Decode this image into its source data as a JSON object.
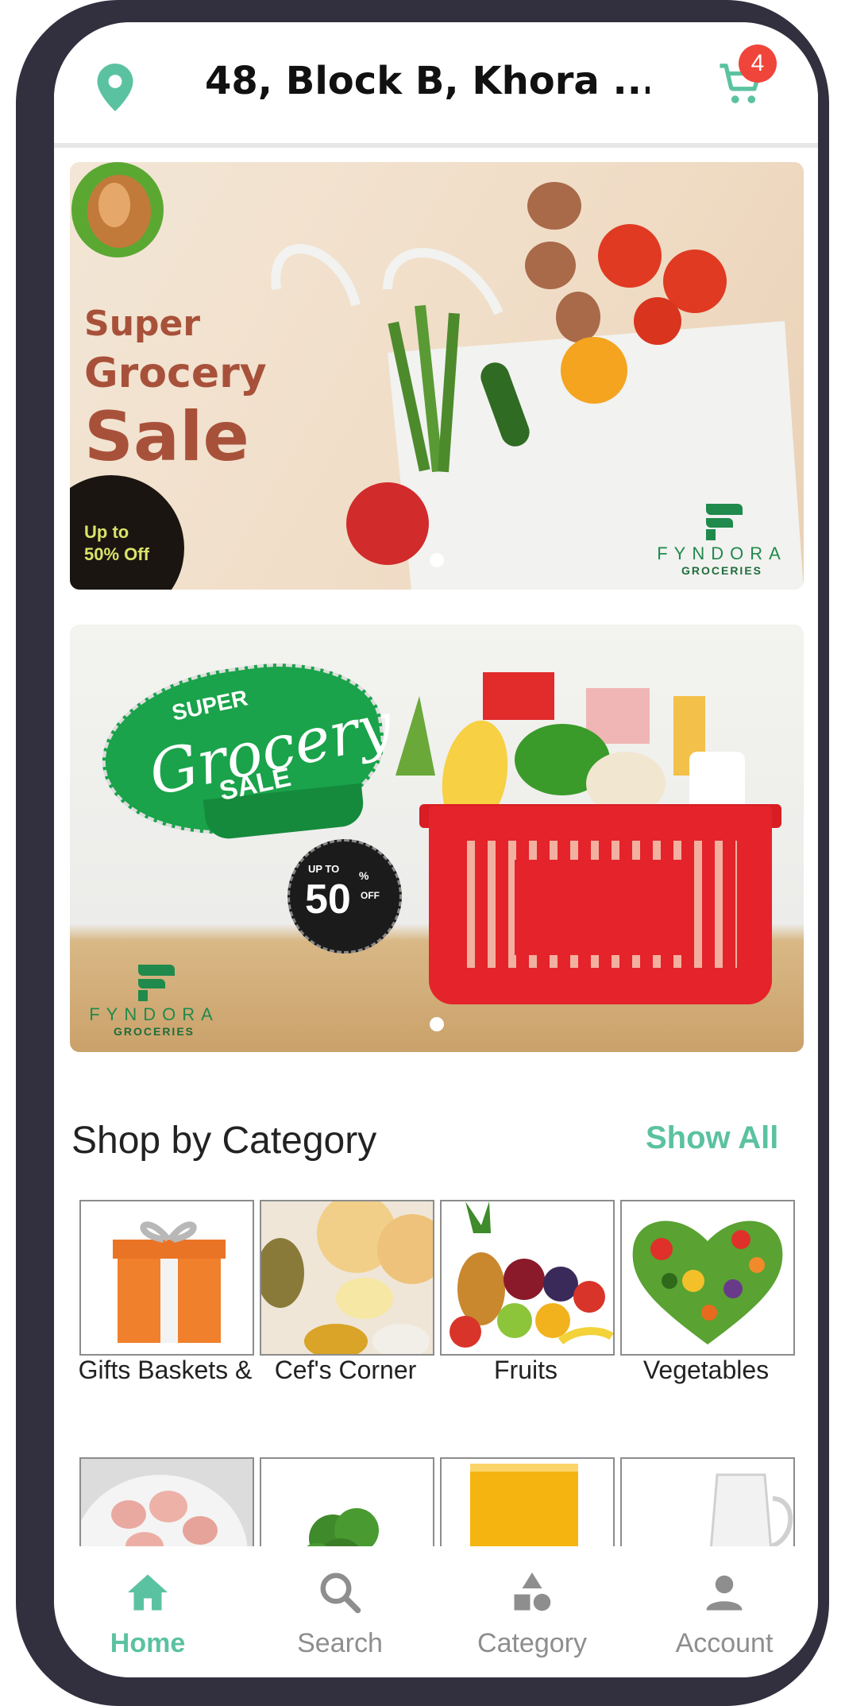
{
  "header": {
    "address": "48, Block B, Khora ...",
    "cart_count": "4"
  },
  "banners": [
    {
      "headline_1": "Super",
      "headline_2": "Grocery",
      "headline_3": "Sale",
      "offer_line_1": "Up to",
      "offer_line_2": "50% Off",
      "brand": "FYNDORA",
      "brand_sub": "GROCERIES"
    },
    {
      "super": "SUPER",
      "grocery": "Grocery",
      "sale": "SALE",
      "up_to": "UP TO",
      "percent_value": "50",
      "percent_sign": "%",
      "off": "OFF",
      "brand": "FYNDORA",
      "brand_sub": "GROCERIES"
    }
  ],
  "categories_section": {
    "title": "Shop by Category",
    "show_all": "Show All",
    "row1": [
      {
        "label": "Gifts Baskets &"
      },
      {
        "label": "Cef's Corner"
      },
      {
        "label": "Fruits"
      },
      {
        "label": "Vegetables"
      }
    ]
  },
  "bottom_nav": [
    {
      "label": "Home",
      "icon": "home-icon",
      "active": true
    },
    {
      "label": "Search",
      "icon": "search-icon",
      "active": false
    },
    {
      "label": "Category",
      "icon": "category-icon",
      "active": false
    },
    {
      "label": "Account",
      "icon": "account-icon",
      "active": false
    }
  ],
  "colors": {
    "accent": "#5bc2a1",
    "badge": "#f0453a",
    "frame": "#32303f",
    "brand_green": "#1f8a4c"
  }
}
